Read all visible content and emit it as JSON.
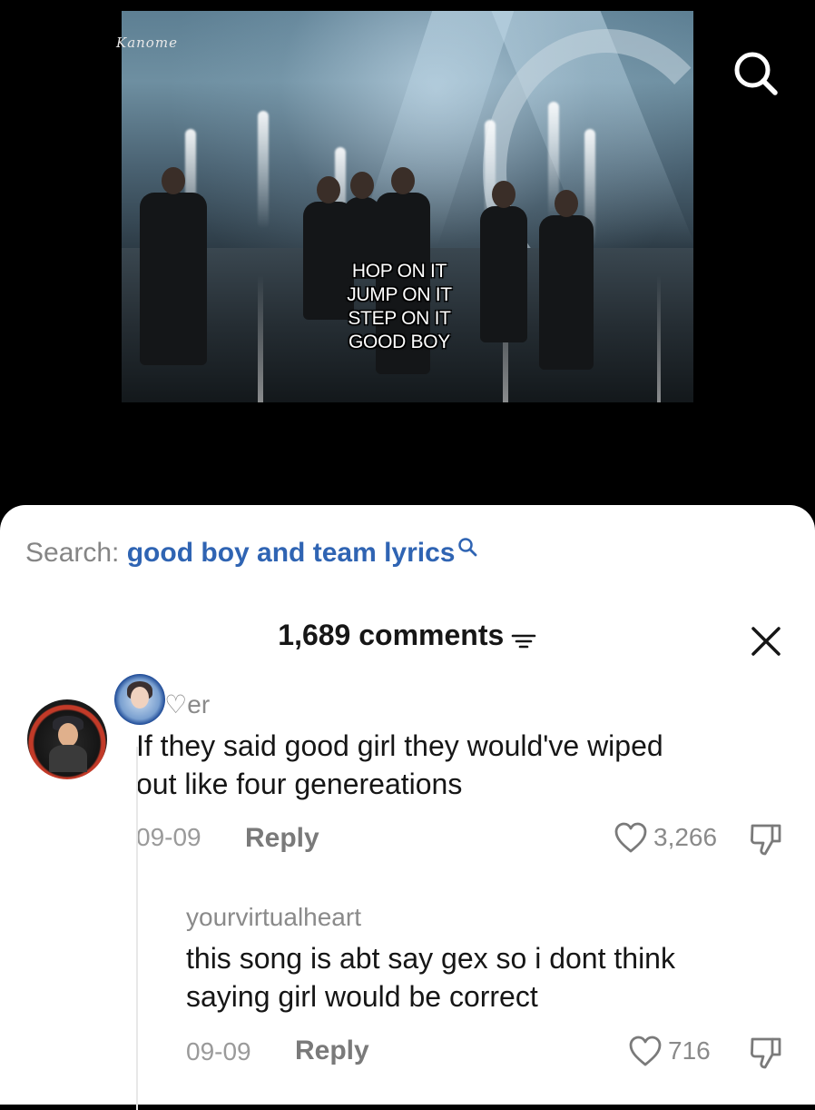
{
  "video": {
    "logo_text": "Kanome",
    "lyrics": [
      "HOP ON IT",
      "JUMP ON IT",
      "STEP ON IT",
      "GOOD BOY"
    ]
  },
  "comments_panel": {
    "search_prefix": "Search:",
    "search_query": "good boy and team lyrics",
    "comment_count": "1,689 comments",
    "comments": [
      {
        "username": "Lo♡er",
        "text_line1": "If they said good girl they would've wiped",
        "text_line2": "out like four genereations",
        "date": "09-09",
        "reply_label": "Reply",
        "likes": "3,266"
      },
      {
        "username": "yourvirtualheart",
        "text_line1": "this song is abt say gex so i dont think",
        "text_line2": "saying girl would be correct",
        "date": "09-09",
        "reply_label": "Reply",
        "likes": "716"
      }
    ]
  },
  "icons": [
    "search-icon",
    "search-small-icon",
    "sort-icon",
    "close-icon",
    "heart-icon",
    "dislike-icon"
  ],
  "colors": {
    "accent_blue": "#2f64b3",
    "text": "#161616",
    "muted": "#8a8a8a",
    "background": "#ffffff"
  }
}
